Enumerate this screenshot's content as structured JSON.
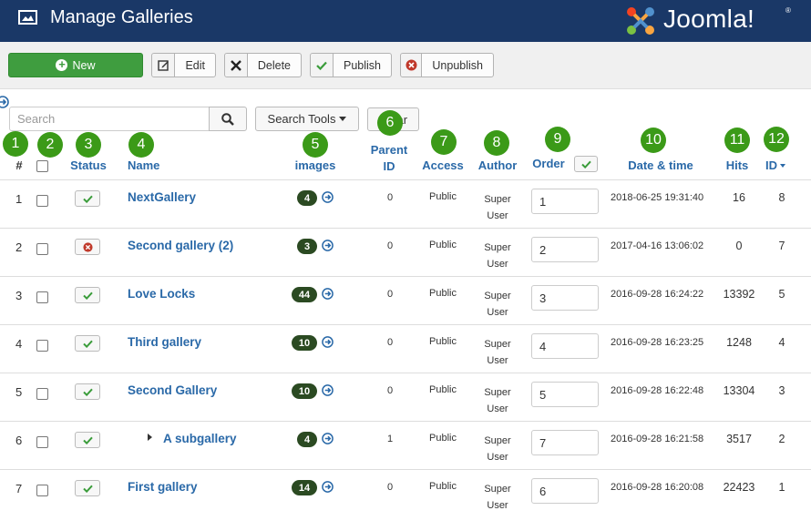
{
  "header": {
    "title": "Manage Galleries",
    "brand": "Joomla!",
    "brand_mark": "®",
    "bg": "#1a3867"
  },
  "toolbar": {
    "new": "New",
    "edit": "Edit",
    "delete": "Delete",
    "publish": "Publish",
    "unpublish": "Unpublish",
    "new_color": "#3f9d3f"
  },
  "search": {
    "placeholder": "Search",
    "value": "",
    "tools_label": "Search Tools",
    "clear_label": "Clear"
  },
  "markers": [
    "1",
    "2",
    "3",
    "4",
    "5",
    "6",
    "7",
    "8",
    "9",
    "10",
    "11",
    "12"
  ],
  "columns": {
    "num": "#",
    "status": "Status",
    "name": "Name",
    "images": "images",
    "parent_top": "Parent",
    "parent_bottom": "ID",
    "access": "Access",
    "author": "Author",
    "order": "Order",
    "date": "Date & time",
    "hits": "Hits",
    "id": "ID"
  },
  "rows": [
    {
      "n": "1",
      "published": true,
      "name": "NextGallery",
      "images": "4",
      "parent": "0",
      "access": "Public",
      "author1": "Super",
      "author2": "User",
      "order": "1",
      "date": "2018-06-25 19:31:40",
      "hits": "16",
      "id": "8"
    },
    {
      "n": "2",
      "published": false,
      "name": "Second gallery (2)",
      "images": "3",
      "parent": "0",
      "access": "Public",
      "author1": "Super",
      "author2": "User",
      "order": "2",
      "date": "2017-04-16 13:06:02",
      "hits": "0",
      "id": "7"
    },
    {
      "n": "3",
      "published": true,
      "name": "Love Locks",
      "images": "44",
      "parent": "0",
      "access": "Public",
      "author1": "Super",
      "author2": "User",
      "order": "3",
      "date": "2016-09-28 16:24:22",
      "hits": "13392",
      "id": "5"
    },
    {
      "n": "4",
      "published": true,
      "name": "Third gallery",
      "images": "10",
      "parent": "0",
      "access": "Public",
      "author1": "Super",
      "author2": "User",
      "order": "4",
      "date": "2016-09-28 16:23:25",
      "hits": "1248",
      "id": "4"
    },
    {
      "n": "5",
      "published": true,
      "name": "Second Gallery",
      "images": "10",
      "parent": "0",
      "access": "Public",
      "author1": "Super",
      "author2": "User",
      "order": "5",
      "date": "2016-09-28 16:22:48",
      "hits": "13304",
      "id": "3"
    },
    {
      "n": "6",
      "published": true,
      "name": "A subgallery",
      "images": "4",
      "parent": "1",
      "access": "Public",
      "author1": "Super",
      "author2": "User",
      "order": "7",
      "date": "2016-09-28 16:21:58",
      "hits": "3517",
      "id": "2",
      "child": true
    },
    {
      "n": "7",
      "published": true,
      "name": "First gallery",
      "images": "14",
      "parent": "0",
      "access": "Public",
      "author1": "Super",
      "author2": "User",
      "order": "6",
      "date": "2016-09-28 16:20:08",
      "hits": "22423",
      "id": "1"
    }
  ],
  "icons": {
    "page": "gallery-icon",
    "new": "plus-circle-icon",
    "edit": "edit-icon",
    "delete": "x-icon",
    "publish": "check-icon",
    "unpublish": "unpublish-icon",
    "search": "search-icon",
    "go": "arrow-circle-icon",
    "sort": "caret-down-icon"
  },
  "colors": {
    "link": "#2a69a8",
    "marker": "#3b9a18",
    "badge": "#2b4a22",
    "check": "#3a9c3a",
    "unpub": "#c0392b"
  }
}
